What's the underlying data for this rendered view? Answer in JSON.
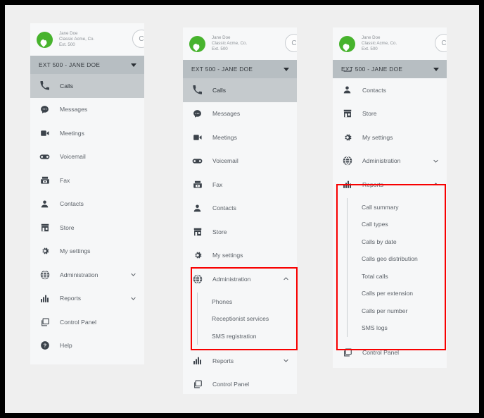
{
  "account": {
    "name": "Jane Doe",
    "company": "Classic Acme, Co.",
    "extension": "Ext. 500",
    "avatar_glyph": "C",
    "logo_icon": "location-pin-icon",
    "brand_color": "#47b32d"
  },
  "extension_selector": {
    "label": "EXT 500 - JANE DOE",
    "caret_icon": "caret-down-icon",
    "background": "#b7bec2"
  },
  "annotation": {
    "color": "#f80000"
  },
  "nav_labels": {
    "calls": "Calls",
    "messages": "Messages",
    "meetings": "Meetings",
    "voicemail": "Voicemail",
    "fax": "Fax",
    "contacts": "Contacts",
    "store": "Store",
    "my_settings": "My settings",
    "administration": "Administration",
    "reports": "Reports",
    "control_panel": "Control Panel",
    "help": "Help"
  },
  "submenus": {
    "administration": [
      "Phones",
      "Receptionist services",
      "SMS registration"
    ],
    "reports": [
      "Call summary",
      "Call types",
      "Calls by date",
      "Calls geo distribution",
      "Total calls",
      "Calls per extension",
      "Calls per number",
      "SMS logs"
    ]
  },
  "panels": [
    {
      "id": "panel-collapsed",
      "items": [
        {
          "label": "Calls",
          "icon": "phone-icon",
          "active": true
        },
        {
          "label": "Messages",
          "icon": "chat-bubble-icon"
        },
        {
          "label": "Meetings",
          "icon": "video-camera-icon"
        },
        {
          "label": "Voicemail",
          "icon": "voicemail-icon"
        },
        {
          "label": "Fax",
          "icon": "fax-icon"
        },
        {
          "label": "Contacts",
          "icon": "contact-icon"
        },
        {
          "label": "Store",
          "icon": "store-icon"
        },
        {
          "label": "My settings",
          "icon": "gear-icon"
        },
        {
          "label": "Administration",
          "icon": "globe-icon",
          "chevron": "chevron-down-icon"
        },
        {
          "label": "Reports",
          "icon": "bar-chart-icon",
          "chevron": "chevron-down-icon"
        },
        {
          "label": "Control Panel",
          "icon": "window-icon"
        },
        {
          "label": "Help",
          "icon": "question-mark-icon"
        }
      ]
    },
    {
      "id": "panel-administration-expanded",
      "items": [
        {
          "label": "Calls",
          "icon": "phone-icon",
          "active": true
        },
        {
          "label": "Messages",
          "icon": "chat-bubble-icon"
        },
        {
          "label": "Meetings",
          "icon": "video-camera-icon"
        },
        {
          "label": "Voicemail",
          "icon": "voicemail-icon"
        },
        {
          "label": "Fax",
          "icon": "fax-icon"
        },
        {
          "label": "Contacts",
          "icon": "contact-icon"
        },
        {
          "label": "Store",
          "icon": "store-icon"
        },
        {
          "label": "My settings",
          "icon": "gear-icon"
        },
        {
          "label": "Administration",
          "icon": "globe-icon",
          "chevron": "chevron-up-icon",
          "expanded": true
        },
        {
          "label": "Reports",
          "icon": "bar-chart-icon",
          "chevron": "chevron-down-icon"
        },
        {
          "label": "Control Panel",
          "icon": "window-icon"
        }
      ]
    },
    {
      "id": "panel-reports-expanded",
      "items": [
        {
          "label": "Contacts",
          "icon": "contact-icon"
        },
        {
          "label": "Store",
          "icon": "store-icon"
        },
        {
          "label": "My settings",
          "icon": "gear-icon"
        },
        {
          "label": "Administration",
          "icon": "globe-icon",
          "chevron": "chevron-down-icon"
        },
        {
          "label": "Reports",
          "icon": "bar-chart-icon",
          "chevron": "chevron-up-icon",
          "expanded": true
        },
        {
          "label": "Control Panel",
          "icon": "window-icon"
        }
      ]
    }
  ]
}
